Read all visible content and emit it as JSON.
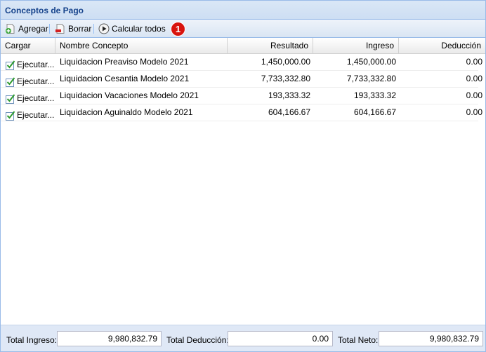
{
  "panel": {
    "title": "Conceptos de Pago"
  },
  "toolbar": {
    "add_label": "Agregar",
    "delete_label": "Borrar",
    "calc_label": "Calcular todos",
    "badge": "1"
  },
  "columns": {
    "cargar": "Cargar",
    "nombre": "Nombre Concepto",
    "resultado": "Resultado",
    "ingreso": "Ingreso",
    "deduccion": "Deducción"
  },
  "rows": [
    {
      "action": "Ejecutar...",
      "nombre": "Liquidacion Preaviso Modelo 2021",
      "resultado": "1,450,000.00",
      "ingreso": "1,450,000.00",
      "deduccion": "0.00"
    },
    {
      "action": "Ejecutar...",
      "nombre": "Liquidacion Cesantia Modelo 2021",
      "resultado": "7,733,332.80",
      "ingreso": "7,733,332.80",
      "deduccion": "0.00"
    },
    {
      "action": "Ejecutar...",
      "nombre": "Liquidacion Vacaciones Modelo 2021",
      "resultado": "193,333.32",
      "ingreso": "193,333.32",
      "deduccion": "0.00"
    },
    {
      "action": "Ejecutar...",
      "nombre": "Liquidacion Aguinaldo Modelo 2021",
      "resultado": "604,166.67",
      "ingreso": "604,166.67",
      "deduccion": "0.00"
    }
  ],
  "footer": {
    "total_ingreso_label": "Total Ingreso:",
    "total_ingreso_value": "9,980,832.79",
    "total_deduccion_label": "Total Deducción:",
    "total_deduccion_value": "0.00",
    "total_neto_label": "Total Neto:",
    "total_neto_value": "9,980,832.79"
  },
  "colors": {
    "header_text": "#15428b",
    "badge": "#d8140e",
    "border": "#99bbe8",
    "footer_bg": "#dfe8f6"
  }
}
